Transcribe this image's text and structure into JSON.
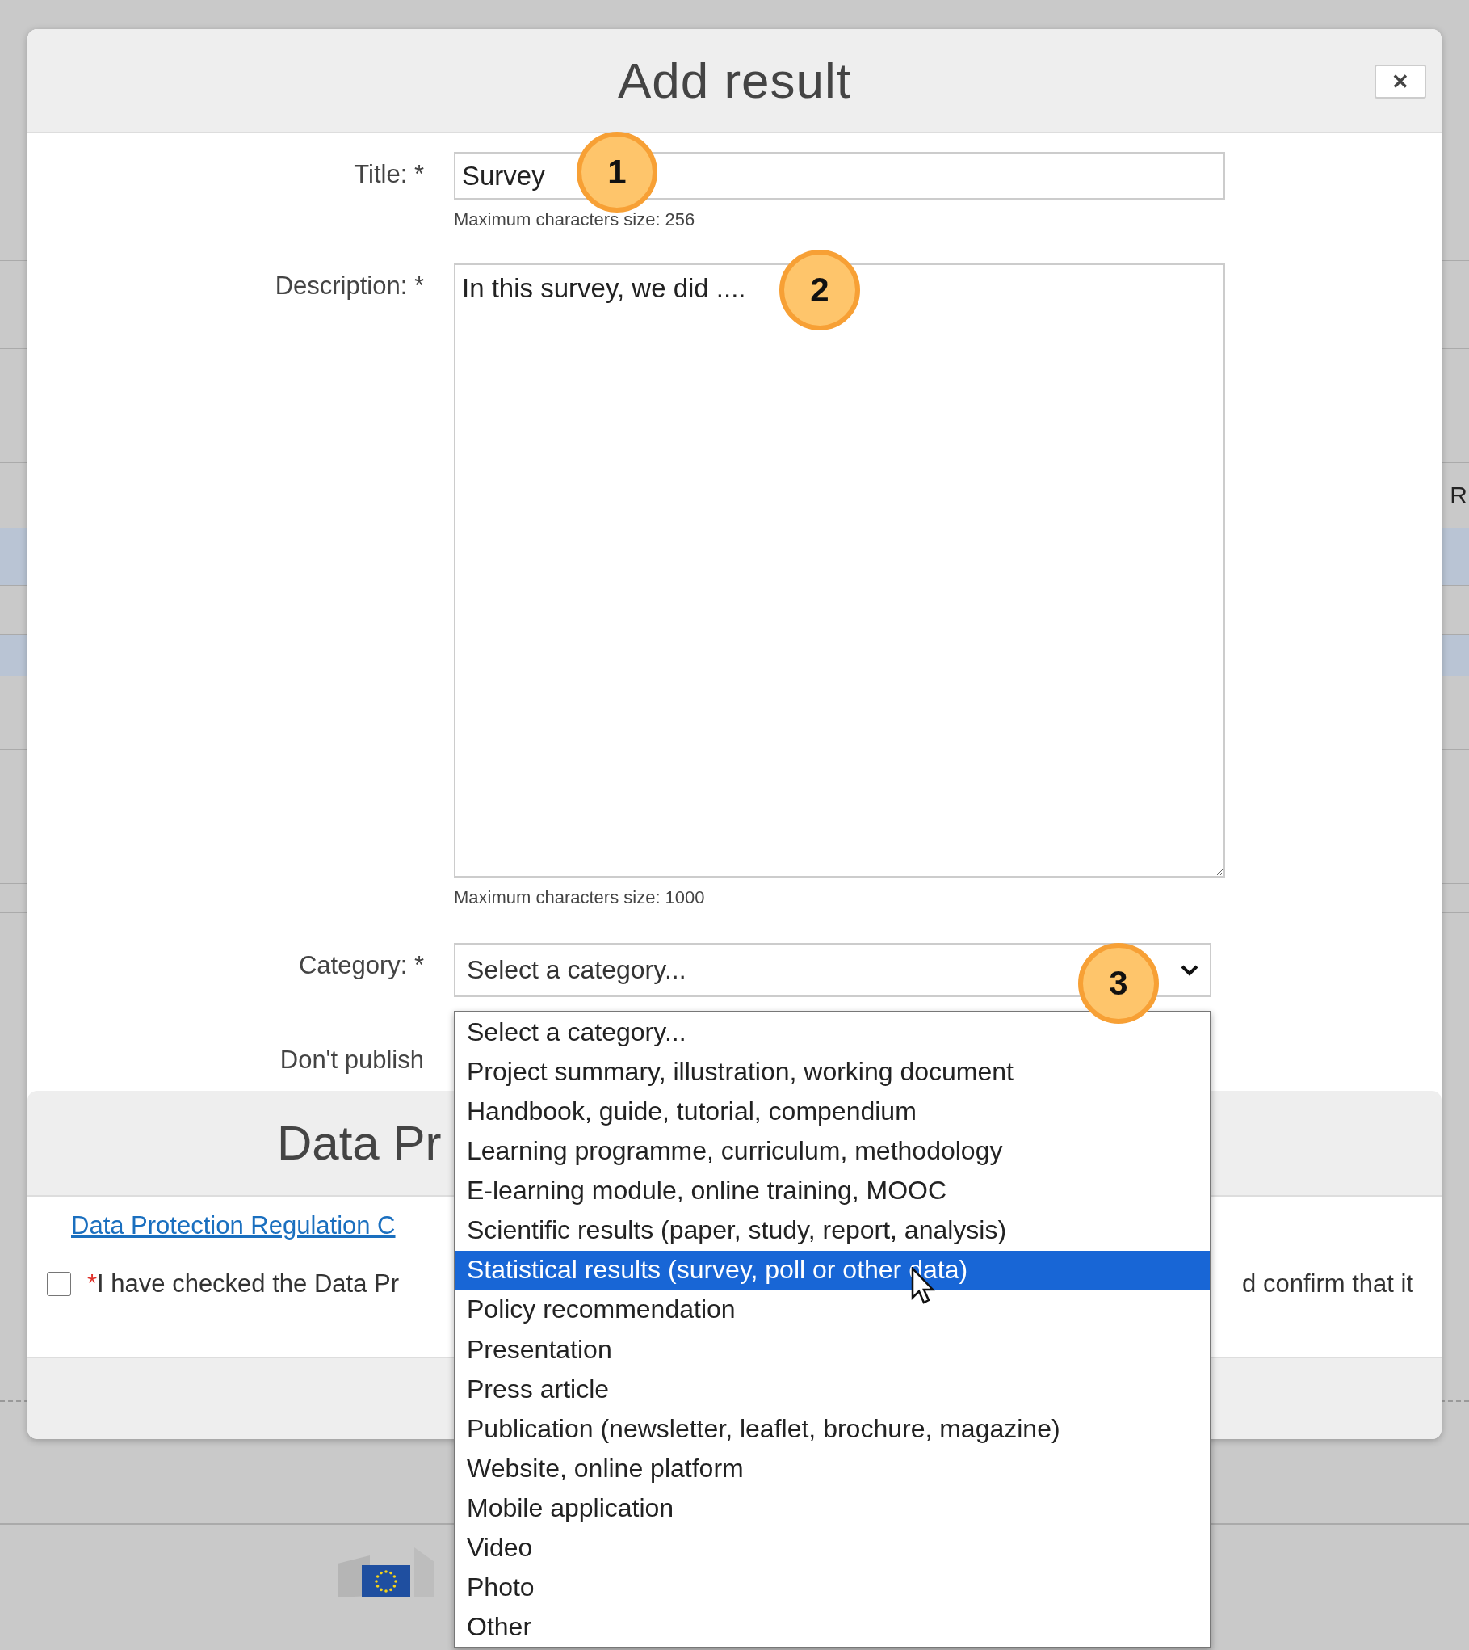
{
  "background": {
    "edge_text": "R"
  },
  "dialog": {
    "title": "Add result",
    "close_label": "✕",
    "fields": [
      {
        "kind": "input",
        "label": "Title: *",
        "value": "Survey",
        "hint": "Maximum characters size: 256"
      },
      {
        "kind": "textarea",
        "label": "Description: *",
        "value": "In this survey, we did ....",
        "hint": "Maximum characters size: 1000"
      },
      {
        "kind": "select",
        "label": "Category: *",
        "value": "Select a category..."
      },
      {
        "kind": "plain",
        "label": "Don't publish"
      }
    ],
    "data_protection": {
      "title": "Data Pr",
      "link": "Data Protection Regulation C",
      "checkbox": {
        "checked": false,
        "required_mark": "*",
        "text_left": "I have checked the Data Pr",
        "text_right": "d confirm that it"
      }
    }
  },
  "dropdown": {
    "options": [
      {
        "label": "Select a category...",
        "selected": false
      },
      {
        "label": "Project summary, illustration, working document",
        "selected": false
      },
      {
        "label": "Handbook, guide, tutorial, compendium",
        "selected": false
      },
      {
        "label": "Learning programme, curriculum, methodology",
        "selected": false
      },
      {
        "label": "E-learning module, online training, MOOC",
        "selected": false
      },
      {
        "label": "Scientific results (paper, study, report, analysis)",
        "selected": false
      },
      {
        "label": "Statistical results (survey, poll or other data)",
        "selected": true
      },
      {
        "label": "Policy recommendation",
        "selected": false
      },
      {
        "label": "Presentation",
        "selected": false
      },
      {
        "label": "Press article",
        "selected": false
      },
      {
        "label": "Publication (newsletter, leaflet, brochure, magazine)",
        "selected": false
      },
      {
        "label": "Website, online platform",
        "selected": false
      },
      {
        "label": "Mobile application",
        "selected": false
      },
      {
        "label": "Video",
        "selected": false
      },
      {
        "label": "Photo",
        "selected": false
      },
      {
        "label": "Other",
        "selected": false
      }
    ]
  },
  "callouts": [
    {
      "number": "1"
    },
    {
      "number": "2"
    },
    {
      "number": "3"
    }
  ]
}
